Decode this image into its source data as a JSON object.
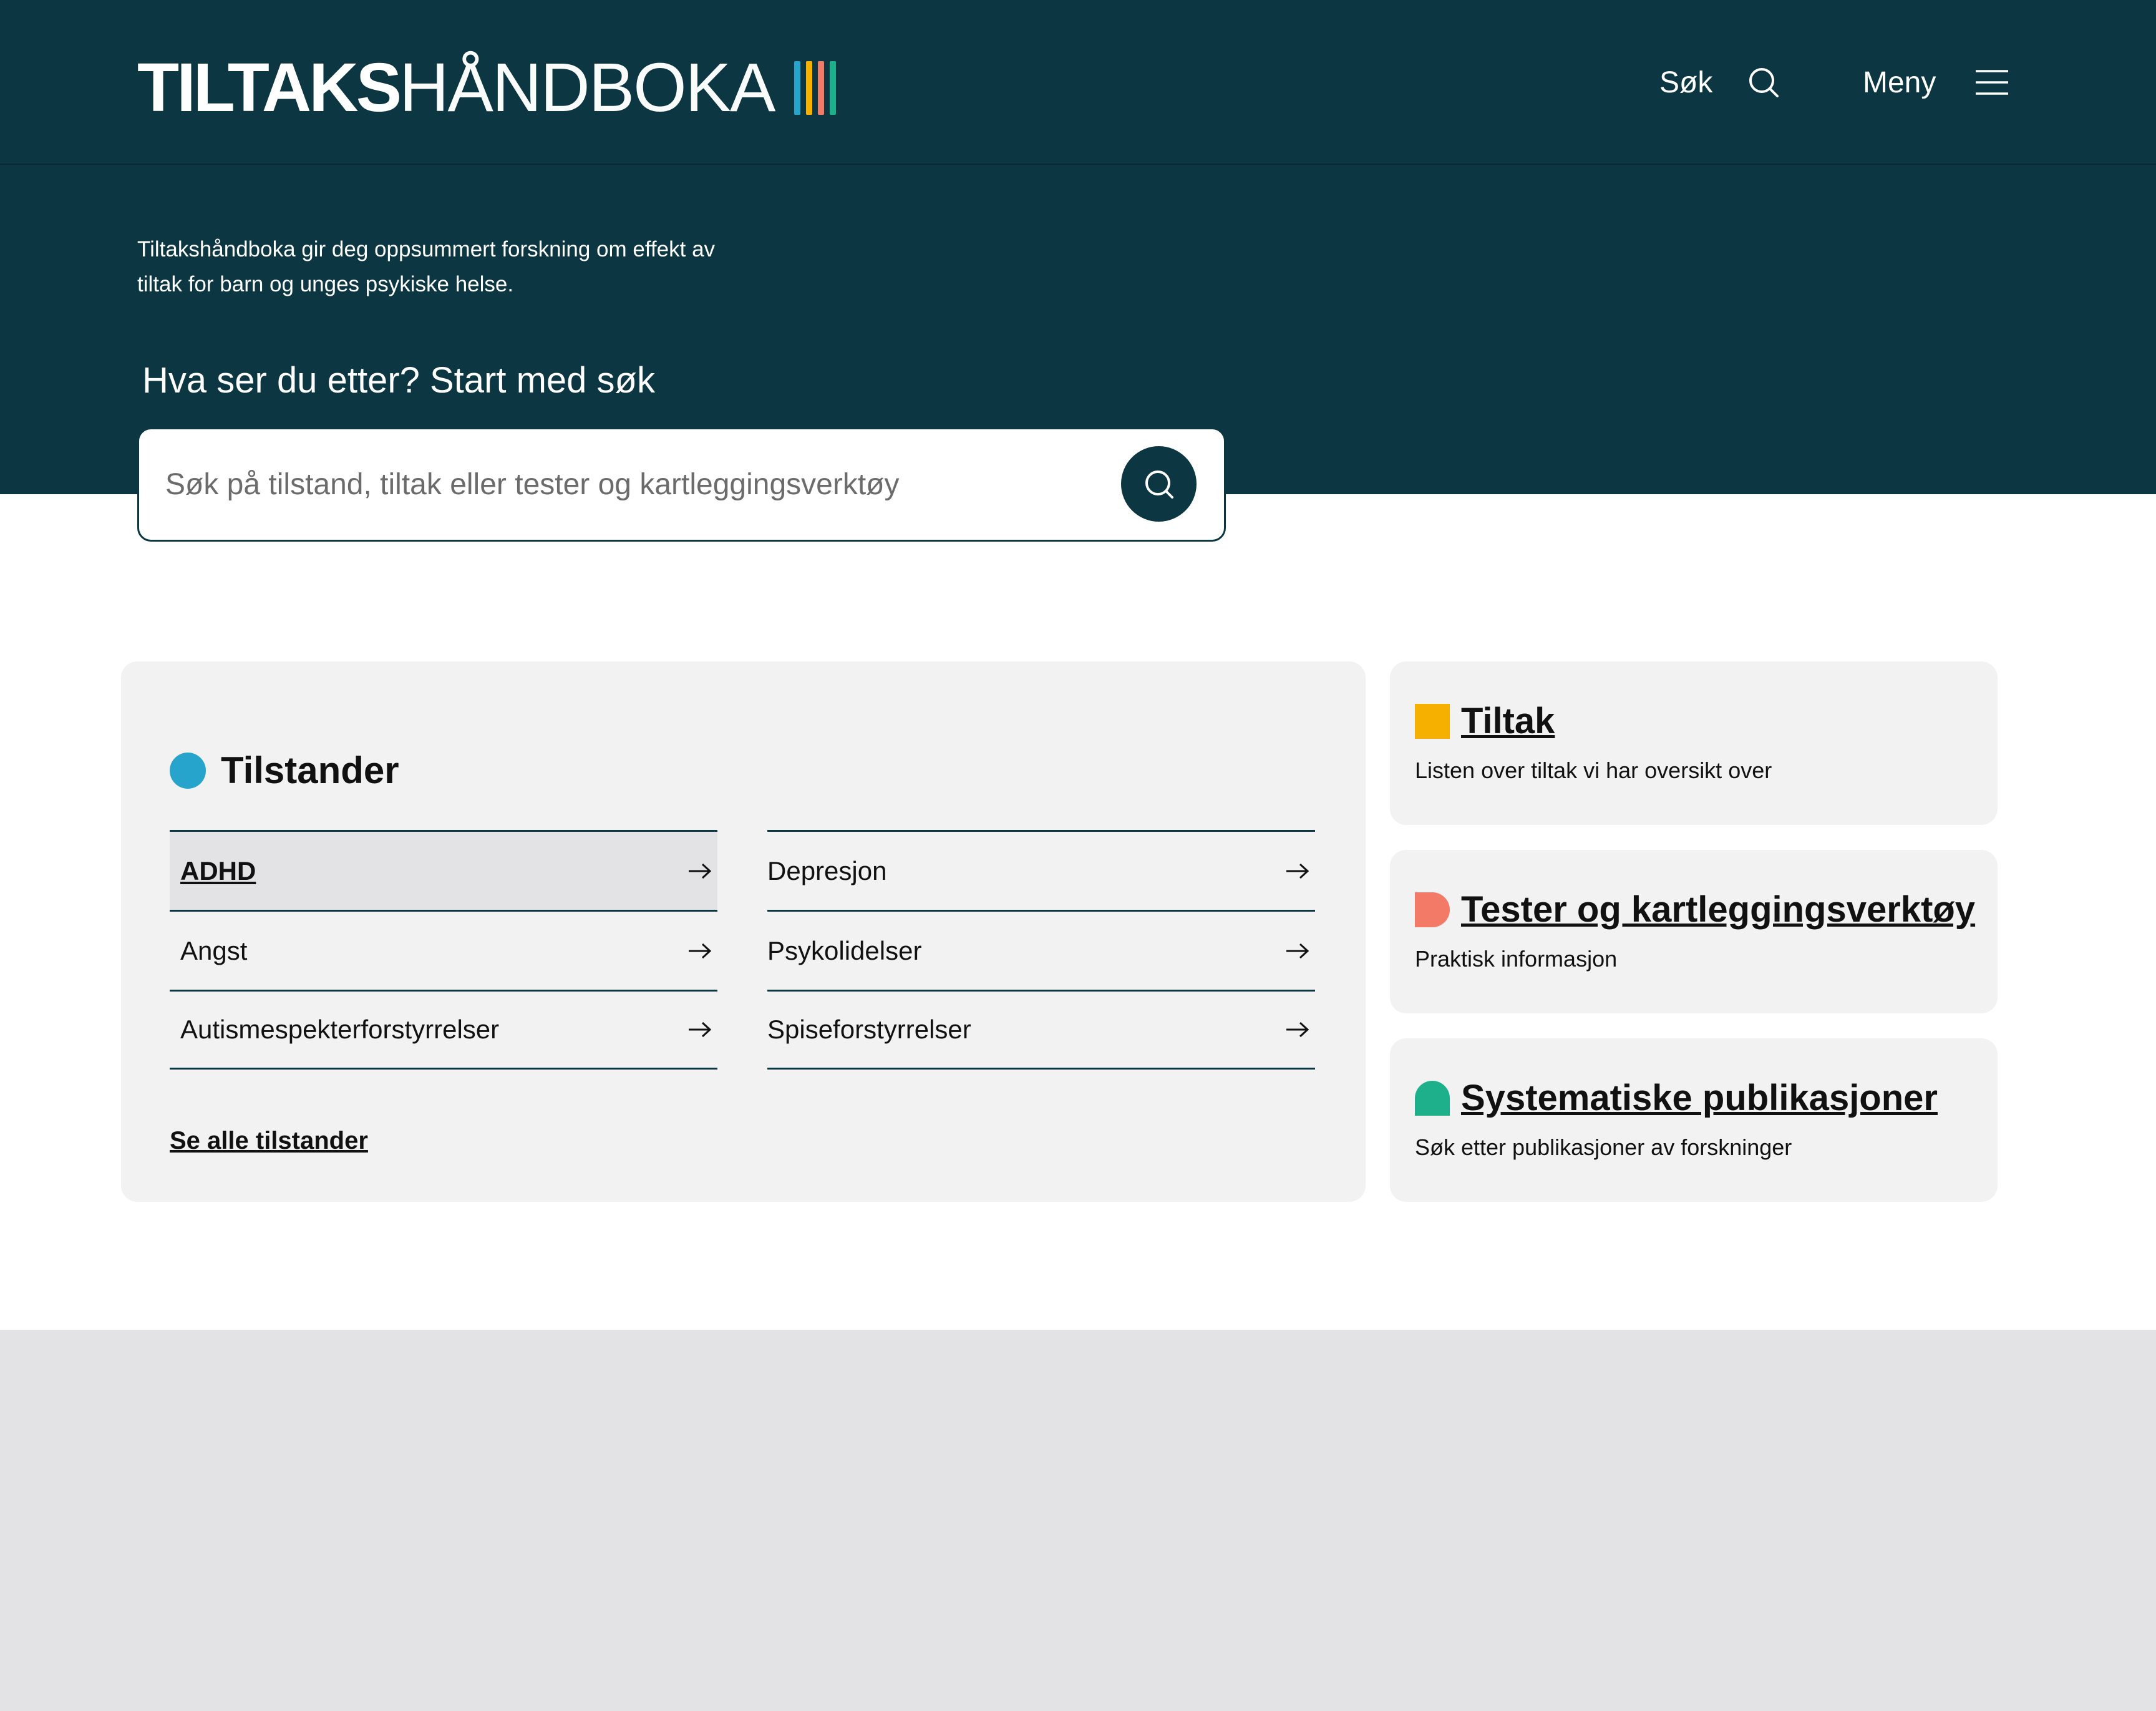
{
  "header": {
    "logo_bold": "TILTAKS",
    "logo_thin": "HÅNDBOKA",
    "logo_bar_colors": [
      "#27a4cb",
      "#f6b000",
      "#f47a68",
      "#1db08a"
    ],
    "search_label": "Søk",
    "menu_label": "Meny"
  },
  "hero": {
    "intro": "Tiltakshåndboka gir deg oppsummert forskning om effekt av tiltak for barn og unges psykiske helse.",
    "search_heading": "Hva ser du etter? Start med søk",
    "search_placeholder": "Søk på tilstand, tiltak eller tester og kartleggingsverktøy"
  },
  "conditions": {
    "title": "Tilstander",
    "dot_color": "#27a4cb",
    "left": [
      "ADHD",
      "Angst",
      "Autismespekterforstyrrelser"
    ],
    "right": [
      "Depresjon",
      "Psykolidelser",
      "Spiseforstyrrelser"
    ],
    "see_all": "Se alle tilstander"
  },
  "cards": [
    {
      "title": "Tiltak",
      "description": "Listen over tiltak vi har oversikt over",
      "color": "#f6b000",
      "icon": "square-icon"
    },
    {
      "title": "Tester og kartleggingsverktøy",
      "description": "Praktisk informasjon",
      "color": "#f47a68",
      "icon": "half-round-icon"
    },
    {
      "title": "Systematiske publikasjoner",
      "description": "Søk etter publikasjoner av forskninger",
      "color": "#1db08a",
      "icon": "arch-icon"
    }
  ]
}
